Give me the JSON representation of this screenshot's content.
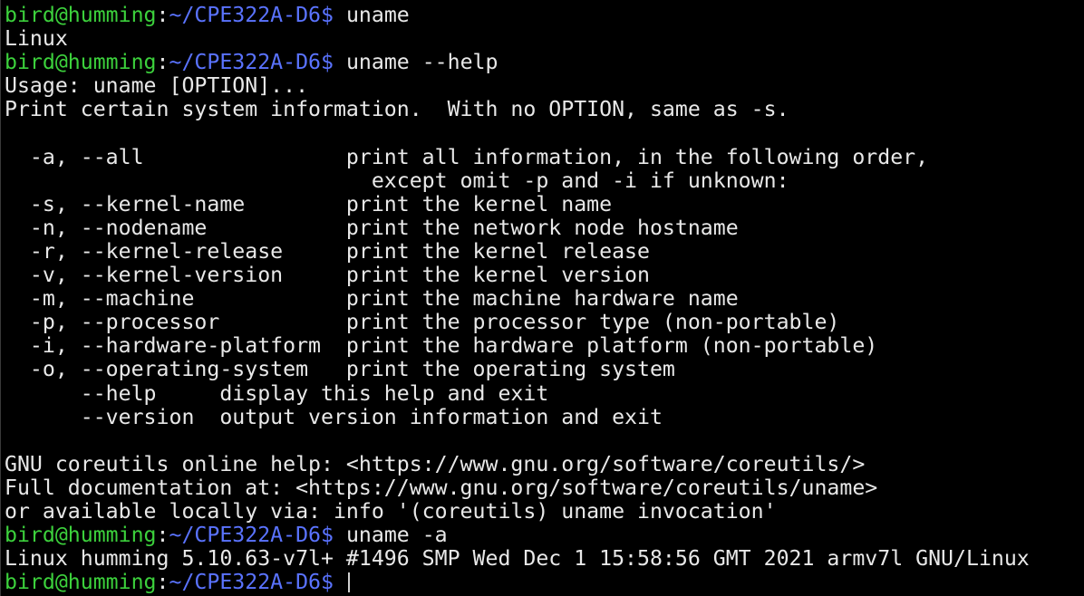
{
  "prompt": {
    "user_host": "bird@humming",
    "separator": ":",
    "path": "~/CPE322A-D6",
    "symbol": "$"
  },
  "colors": {
    "background": "#000000",
    "user_host": "#3cd13c",
    "path": "#5a73ff",
    "text": "#e8e8e8"
  },
  "lines": [
    {
      "type": "prompt",
      "command": " uname"
    },
    {
      "type": "output",
      "text": "Linux"
    },
    {
      "type": "prompt",
      "command": " uname --help"
    },
    {
      "type": "output",
      "text": "Usage: uname [OPTION]..."
    },
    {
      "type": "output",
      "text": "Print certain system information.  With no OPTION, same as -s."
    },
    {
      "type": "output",
      "text": ""
    },
    {
      "type": "output",
      "text": "  -a, --all                print all information, in the following order,"
    },
    {
      "type": "output",
      "text": "                             except omit -p and -i if unknown:"
    },
    {
      "type": "output",
      "text": "  -s, --kernel-name        print the kernel name"
    },
    {
      "type": "output",
      "text": "  -n, --nodename           print the network node hostname"
    },
    {
      "type": "output",
      "text": "  -r, --kernel-release     print the kernel release"
    },
    {
      "type": "output",
      "text": "  -v, --kernel-version     print the kernel version"
    },
    {
      "type": "output",
      "text": "  -m, --machine            print the machine hardware name"
    },
    {
      "type": "output",
      "text": "  -p, --processor          print the processor type (non-portable)"
    },
    {
      "type": "output",
      "text": "  -i, --hardware-platform  print the hardware platform (non-portable)"
    },
    {
      "type": "output",
      "text": "  -o, --operating-system   print the operating system"
    },
    {
      "type": "output",
      "text": "      --help     display this help and exit"
    },
    {
      "type": "output",
      "text": "      --version  output version information and exit"
    },
    {
      "type": "output",
      "text": ""
    },
    {
      "type": "output",
      "text": "GNU coreutils online help: <https://www.gnu.org/software/coreutils/>"
    },
    {
      "type": "output",
      "text": "Full documentation at: <https://www.gnu.org/software/coreutils/uname>"
    },
    {
      "type": "output",
      "text": "or available locally via: info '(coreutils) uname invocation'"
    },
    {
      "type": "prompt",
      "command": " uname -a"
    },
    {
      "type": "output",
      "text": "Linux humming 5.10.63-v7l+ #1496 SMP Wed Dec 1 15:58:56 GMT 2021 armv7l GNU/Linux"
    },
    {
      "type": "prompt",
      "command": " ",
      "cursor": true
    }
  ]
}
